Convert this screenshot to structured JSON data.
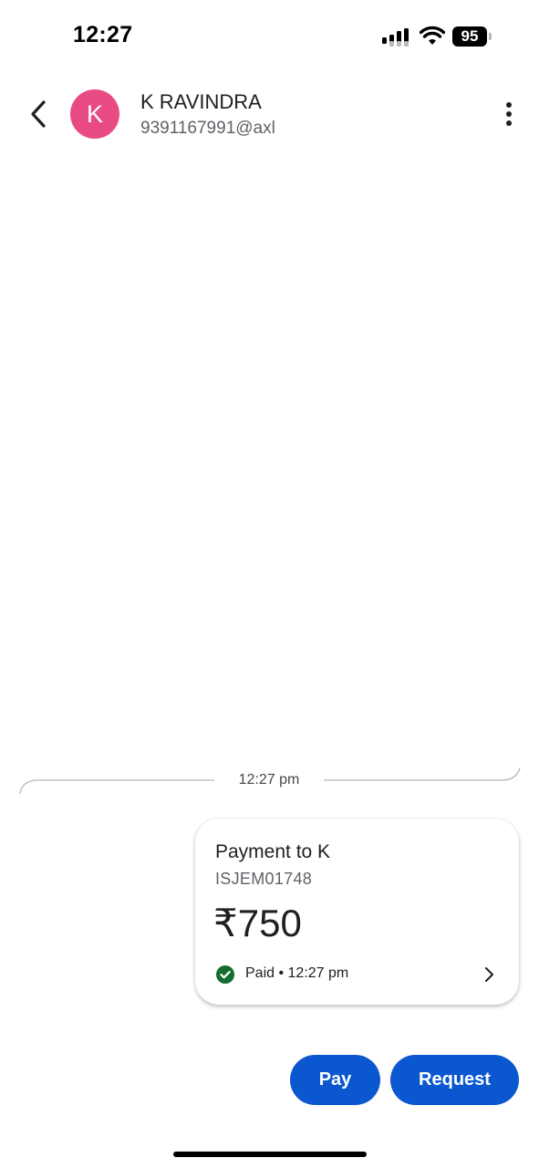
{
  "status_bar": {
    "time": "12:27",
    "battery": "95"
  },
  "header": {
    "avatar_letter": "K",
    "avatar_color": "#e84b84",
    "contact_name": "K RAVINDRA",
    "upi_id": "9391167991@axl"
  },
  "chat": {
    "timestamp": "12:27 pm",
    "payment": {
      "title": "Payment to K",
      "reference": "ISJEM01748",
      "amount": "₹750",
      "status": "Paid • 12:27 pm",
      "status_color": "#146c2e"
    }
  },
  "actions": {
    "pay_label": "Pay",
    "request_label": "Request",
    "accent": "#0b57d0"
  },
  "icons": {
    "back": "back-arrow-icon",
    "more": "more-vert-icon",
    "paid": "check-circle-icon",
    "open": "chevron-right-icon"
  }
}
